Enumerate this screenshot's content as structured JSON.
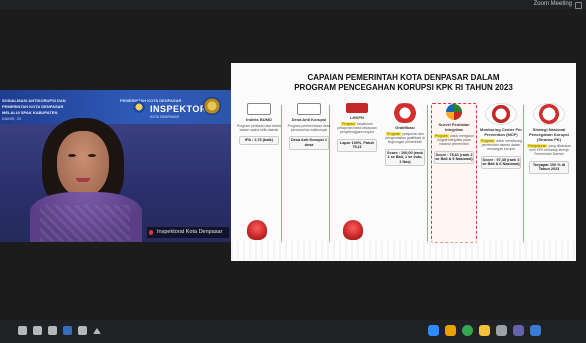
{
  "window": {
    "title": "Zoom Meeting"
  },
  "speaker": {
    "banner": {
      "line1": "SOSIALISASI ANTIKORUPSI DAN",
      "line2": "PEMERINTAH KOTA DENPASAR",
      "line3": "MELALUI SPAK KABUPATEN",
      "org_small": "PEMERINTAH KOTA DENPASAR",
      "org_big": "INSPEKTORAT",
      "org_sub": "KOTA DENPASAR",
      "kanim": "KAMIS, 20"
    },
    "name_label": "Inspektorat Kota Denpasar"
  },
  "slide": {
    "title_line1": "CAPAIAN PEMERINTAH KOTA DENPASAR DALAM",
    "title_line2": "PROGRAM PENCEGAHAN KORUPSI KPK RI TAHUN 2023",
    "columns": [
      {
        "name": "Strategi Nasional Pencegahan Korupsi (Stranas PK)",
        "desc_hl": "Pengukuran",
        "desc": "yang dilakukan oleh KPK terhadap kinerja Pemerintah Daerah",
        "score": "Terpapar 100 % di Tahun 2023"
      },
      {
        "name": "Monitoring Center For Prevention (MCP)",
        "desc_hl": "Program",
        "desc": "untuk mendorong pemerintah daerah dalam mencegah korupsi",
        "score": "Score : 97,35 (rank 3 se Bali & 6 Nasional)"
      },
      {
        "name": "Survei Penilaian Integritas",
        "desc_hl": "Program",
        "desc": "untuk mengukur tingkat integritas pada instansi pemerintah",
        "score": "Score : 78,61 (rank 2 se Bali & 9 Nasional)"
      },
      {
        "name": "Gratifikasi",
        "desc_hl": "Program",
        "desc": "pelaporan dan pengendalian gratifikasi di lingkungan pemerintah",
        "score": "Score : 100,00 (rank 1 se Bali, 1 se Indo, 1 Nas)"
      },
      {
        "name": "LHKPN",
        "desc_hl": "Program",
        "desc": "kepatuhan pelaporan harta kekayaan penyelenggara negara",
        "score": "Lapor 100%, Patuh 75,11"
      },
      {
        "name": "Desa Anti Korupsi",
        "desc_hl": "",
        "desc": "Program pembentukan desa percontohan antikorupsi",
        "score": "Desa Anti Korupsi 1 desa"
      },
      {
        "name": "Indeks BUMD",
        "desc_hl": "",
        "desc": "Program penilaian tata kelola badan usaha milik daerah",
        "score": "IPA : 2,76 (baik)"
      }
    ]
  },
  "taskbar": {
    "left_icons": [
      "mic-icon",
      "video-icon",
      "share-icon",
      "participants-icon",
      "chat-icon",
      "chevron-up-icon"
    ],
    "right_icons": [
      "zoom-icon",
      "store-icon",
      "chrome-icon",
      "folder-icon",
      "files-icon",
      "teams-icon",
      "windows-icon"
    ],
    "colors": {
      "zoom": "#2d8cff",
      "store": "#e8a100",
      "chrome": "#34a853",
      "folder": "#f3c23b",
      "teams": "#6264a7",
      "windows": "#3a7bd5"
    }
  }
}
